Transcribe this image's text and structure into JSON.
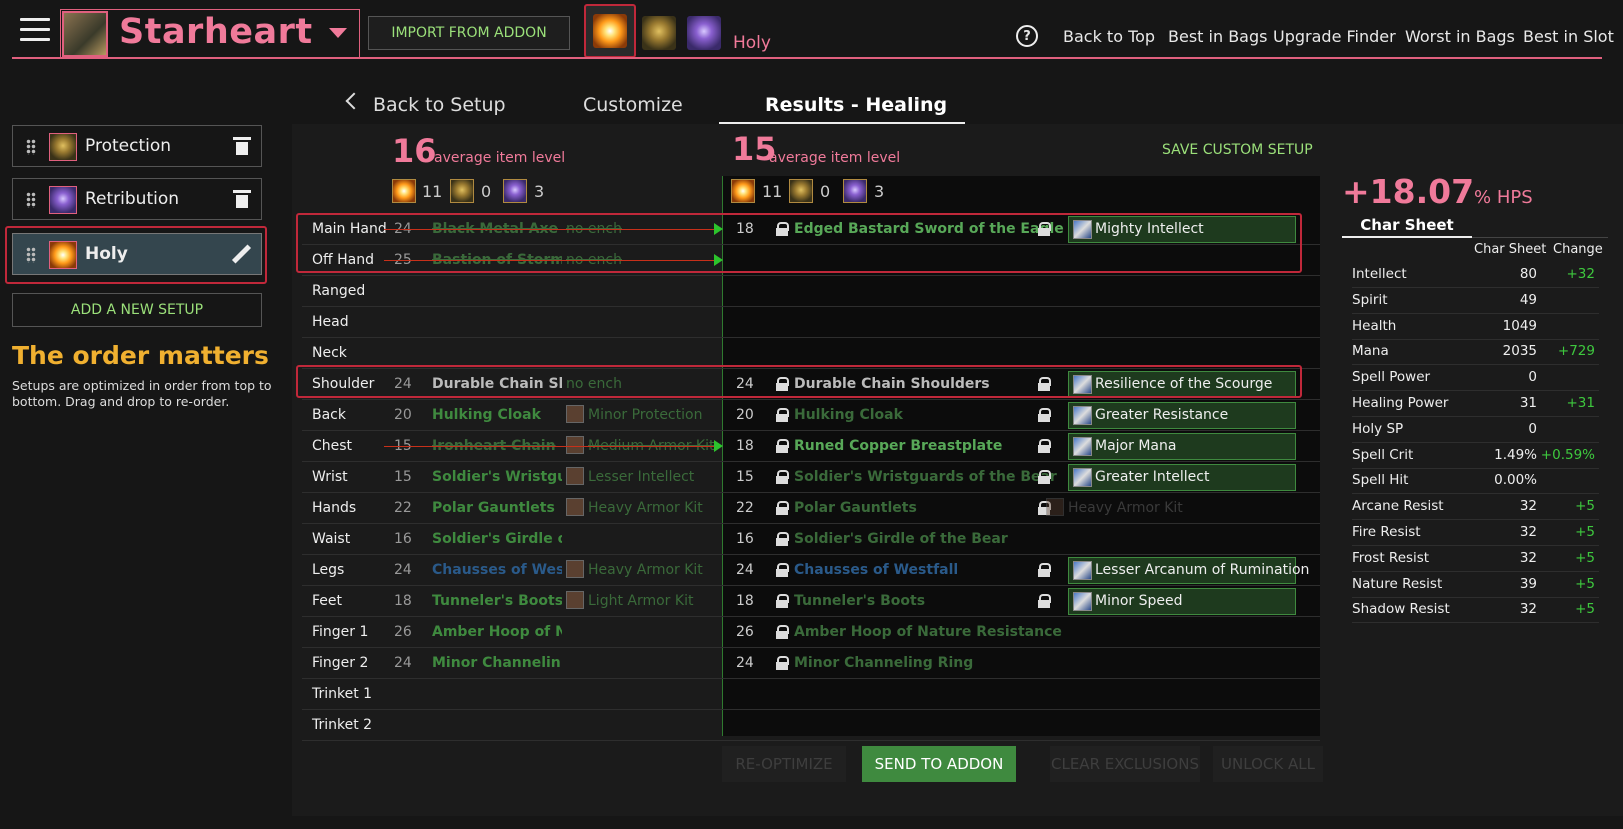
{
  "character": {
    "name": "Starheart",
    "import_label": "IMPORT FROM ADDON",
    "selected_spec_label": "Holy"
  },
  "header_nav": [
    "Back to Top",
    "Best in Bags",
    "Upgrade Finder",
    "Worst in Bags",
    "Best in Slot"
  ],
  "setups": [
    {
      "label": "Protection",
      "icon": "protection-icon",
      "selected": false
    },
    {
      "label": "Retribution",
      "icon": "retribution-icon",
      "selected": false
    },
    {
      "label": "Holy",
      "icon": "holy-icon",
      "selected": true
    }
  ],
  "add_setup_label": "ADD A NEW SETUP",
  "order": {
    "title": "The order matters",
    "desc": "Setups are optimized in order from top to bottom. Drag and drop to re-order."
  },
  "tabs": {
    "back": "Back to Setup",
    "customize": "Customize",
    "results": "Results - Healing"
  },
  "current": {
    "avg_ilvl": "16",
    "avg_label": "average item level",
    "counts": [
      "11",
      "0",
      "3"
    ]
  },
  "optimized": {
    "avg_ilvl": "15",
    "avg_label": "average item level",
    "counts": [
      "11",
      "0",
      "3"
    ]
  },
  "save_custom_label": "SAVE CUSTOM SETUP",
  "gear_rows": [
    {
      "slot": "Main Hand",
      "cur_ilvl": "24",
      "cur_item": "Black Metal Axe",
      "cur_ench": "no ench",
      "new_ilvl": "18",
      "new_item": "Edged Bastard Sword of the Eagle",
      "new_ench": "Mighty Intellect"
    },
    {
      "slot": "Off Hand",
      "cur_ilvl": "25",
      "cur_item": "Bastion of Storm...",
      "cur_ench": "no ench",
      "new_ilvl": "",
      "new_item": "",
      "new_ench": ""
    },
    {
      "slot": "Ranged",
      "cur_ilvl": "",
      "cur_item": "",
      "cur_ench": "",
      "new_ilvl": "",
      "new_item": "",
      "new_ench": ""
    },
    {
      "slot": "Head",
      "cur_ilvl": "",
      "cur_item": "",
      "cur_ench": "",
      "new_ilvl": "",
      "new_item": "",
      "new_ench": ""
    },
    {
      "slot": "Neck",
      "cur_ilvl": "",
      "cur_item": "",
      "cur_ench": "",
      "new_ilvl": "",
      "new_item": "",
      "new_ench": ""
    },
    {
      "slot": "Shoulder",
      "cur_ilvl": "24",
      "cur_item": "Durable Chain Sh...",
      "cur_ench": "no ench",
      "new_ilvl": "24",
      "new_item": "Durable Chain Shoulders",
      "new_ench": "Resilience of the Scourge"
    },
    {
      "slot": "Back",
      "cur_ilvl": "20",
      "cur_item": "Hulking Cloak",
      "cur_ench": "Minor Protection",
      "new_ilvl": "20",
      "new_item": "Hulking Cloak",
      "new_ench": "Greater Resistance"
    },
    {
      "slot": "Chest",
      "cur_ilvl": "15",
      "cur_item": "Ironheart Chain",
      "cur_ench": "Medium Armor Kit",
      "new_ilvl": "18",
      "new_item": "Runed Copper Breastplate",
      "new_ench": "Major Mana"
    },
    {
      "slot": "Wrist",
      "cur_ilvl": "15",
      "cur_item": "Soldier's Wristgu...",
      "cur_ench": "Lesser Intellect",
      "new_ilvl": "15",
      "new_item": "Soldier's Wristguards of the Bear",
      "new_ench": "Greater Intellect"
    },
    {
      "slot": "Hands",
      "cur_ilvl": "22",
      "cur_item": "Polar Gauntlets",
      "cur_ench": "Heavy Armor Kit",
      "new_ilvl": "22",
      "new_item": "Polar Gauntlets",
      "new_ench": "Heavy Armor Kit"
    },
    {
      "slot": "Waist",
      "cur_ilvl": "16",
      "cur_item": "Soldier's Girdle o...",
      "cur_ench": "",
      "new_ilvl": "16",
      "new_item": "Soldier's Girdle of the Bear",
      "new_ench": ""
    },
    {
      "slot": "Legs",
      "cur_ilvl": "24",
      "cur_item": "Chausses of West...",
      "cur_ench": "Heavy Armor Kit",
      "new_ilvl": "24",
      "new_item": "Chausses of Westfall",
      "new_ench": "Lesser Arcanum of Rumination"
    },
    {
      "slot": "Feet",
      "cur_ilvl": "18",
      "cur_item": "Tunneler's Boots",
      "cur_ench": "Light Armor Kit",
      "new_ilvl": "18",
      "new_item": "Tunneler's Boots",
      "new_ench": "Minor Speed"
    },
    {
      "slot": "Finger 1",
      "cur_ilvl": "26",
      "cur_item": "Amber Hoop of N...",
      "cur_ench": "",
      "new_ilvl": "26",
      "new_item": "Amber Hoop of Nature Resistance",
      "new_ench": ""
    },
    {
      "slot": "Finger 2",
      "cur_ilvl": "24",
      "cur_item": "Minor Channelin...",
      "cur_ench": "",
      "new_ilvl": "24",
      "new_item": "Minor Channeling Ring",
      "new_ench": ""
    },
    {
      "slot": "Trinket 1",
      "cur_ilvl": "",
      "cur_item": "",
      "cur_ench": "",
      "new_ilvl": "",
      "new_item": "",
      "new_ench": ""
    },
    {
      "slot": "Trinket 2",
      "cur_ilvl": "",
      "cur_item": "",
      "cur_ench": "",
      "new_ilvl": "",
      "new_item": "",
      "new_ench": ""
    }
  ],
  "buttons": {
    "reoptimize": "RE-OPTIMIZE",
    "send": "SEND TO ADDON",
    "clear": "CLEAR EXCLUSIONS",
    "unlock": "UNLOCK ALL"
  },
  "hps": {
    "value": "+18.07",
    "unit": "% HPS"
  },
  "char_sheet": {
    "tab": "Char Sheet",
    "col1": "Char Sheet",
    "col2": "Change",
    "stats": [
      {
        "name": "Intellect",
        "value": "80",
        "change": "+32"
      },
      {
        "name": "Spirit",
        "value": "49",
        "change": ""
      },
      {
        "name": "Health",
        "value": "1049",
        "change": ""
      },
      {
        "name": "Mana",
        "value": "2035",
        "change": "+729"
      },
      {
        "name": "Spell Power",
        "value": "0",
        "change": ""
      },
      {
        "name": "Healing Power",
        "value": "31",
        "change": "+31"
      },
      {
        "name": "Holy SP",
        "value": "0",
        "change": ""
      },
      {
        "name": "Spell Crit",
        "value": "1.49%",
        "change": "+0.59%"
      },
      {
        "name": "Spell Hit",
        "value": "0.00%",
        "change": ""
      },
      {
        "name": "Arcane Resist",
        "value": "32",
        "change": "+5"
      },
      {
        "name": "Fire Resist",
        "value": "32",
        "change": "+5"
      },
      {
        "name": "Frost Resist",
        "value": "32",
        "change": "+5"
      },
      {
        "name": "Nature Resist",
        "value": "39",
        "change": "+5"
      },
      {
        "name": "Shadow Resist",
        "value": "32",
        "change": "+5"
      }
    ]
  },
  "colors": {
    "accent": "#f07a9a",
    "green": "#3f8a3f",
    "highlight_box": "#c0283a",
    "heading_gold": "#f0b030"
  }
}
